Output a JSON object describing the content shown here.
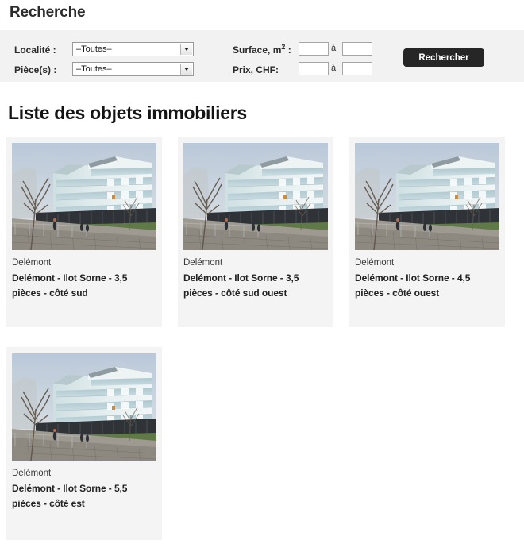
{
  "search": {
    "heading": "Recherche",
    "labels": {
      "locality": "Localité :",
      "rooms": "Pièce(s) :",
      "surface_prefix": "Surface, m",
      "surface_exp": "2",
      "surface_suffix": " :",
      "price": "Prix, CHF:"
    },
    "selects": {
      "locality_value": "–Toutes–",
      "rooms_value": "–Toutes–",
      "options": [
        "–Toutes–"
      ]
    },
    "inputs": {
      "surface_min": "",
      "surface_max": "",
      "price_min": "",
      "price_max": "",
      "range_separator": "à"
    },
    "submit_label": "Rechercher",
    "panel_color": "#f2f2f2",
    "button_color": "#262626"
  },
  "list": {
    "heading": "Liste des objets immobiliers",
    "card_background": "#f4f4f4",
    "items": [
      {
        "locality": "Delémont",
        "title": "Delémont - Ilot Sorne - 3,5 pièces - côté sud",
        "image_alt": "architectural-rendering-apartment-building"
      },
      {
        "locality": "Delémont",
        "title": "Delémont - Ilot Sorne - 3,5 pièces - côté sud ouest",
        "image_alt": "architectural-rendering-apartment-building"
      },
      {
        "locality": "Delémont",
        "title": "Delémont - Ilot Sorne - 4,5 pièces - côté ouest",
        "image_alt": "architectural-rendering-apartment-building"
      },
      {
        "locality": "Delémont",
        "title": "Delémont - Ilot Sorne - 5,5 pièces - côté est",
        "image_alt": "architectural-rendering-apartment-building"
      }
    ]
  }
}
